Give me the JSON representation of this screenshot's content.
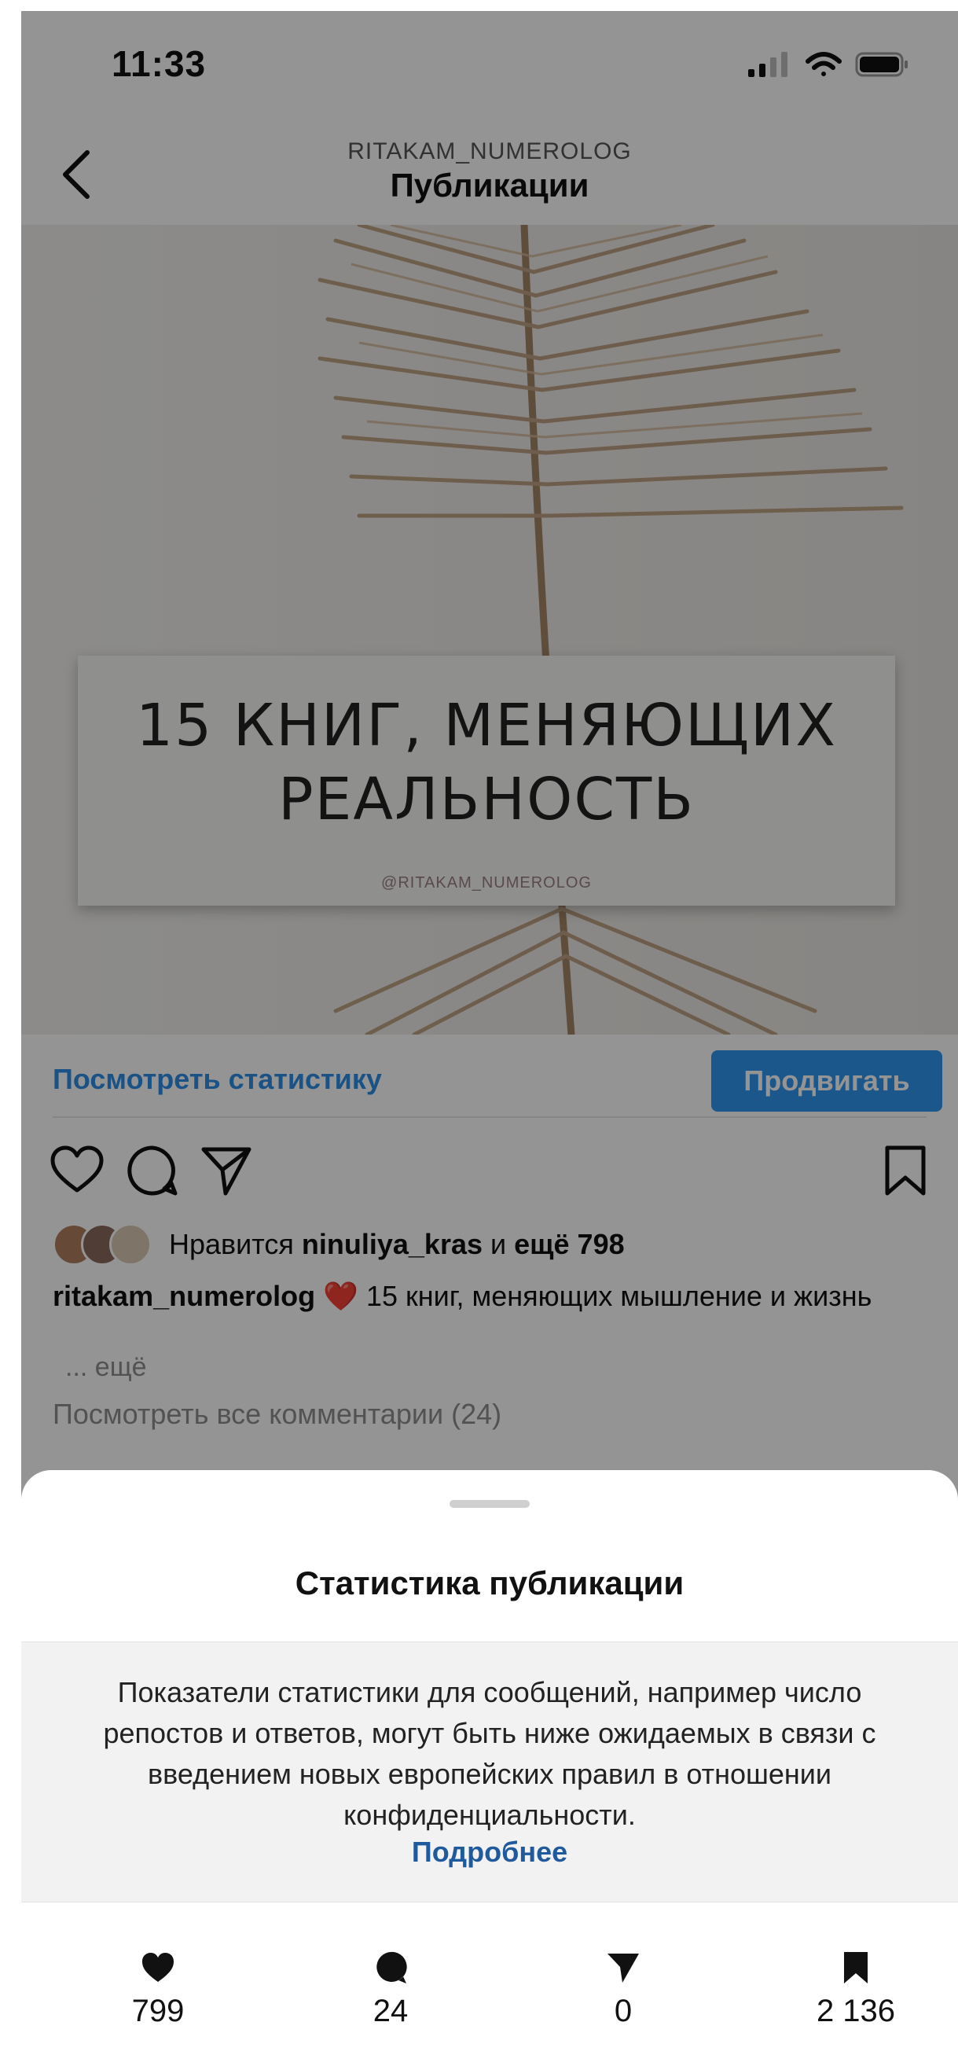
{
  "status_bar": {
    "time": "11:33"
  },
  "nav": {
    "subtitle": "RITAKAM_NUMEROLOG",
    "title": "Публикации"
  },
  "post_image": {
    "headline_line1": "15 КНИГ, МЕНЯЮЩИХ",
    "headline_line2": "РЕАЛЬНОСТЬ",
    "watermark": "@RITAKAM_NUMEROLOG"
  },
  "actions": {
    "view_stats_label": "Посмотреть статистику",
    "promote_label": "Продвигать"
  },
  "likes": {
    "prefix": "Нравится",
    "user": "ninuliya_kras",
    "middle": "и",
    "others": "ещё 798"
  },
  "caption": {
    "username": "ritakam_numerolog",
    "emoji": "❤️",
    "text": "15 книг, меняющих мышление и жизнь",
    "more": "... ещё"
  },
  "comments_link": "Посмотреть все комментарии (24)",
  "sheet": {
    "title": "Статистика публикации",
    "notice": "Показатели статистики для сообщений, например число репостов и ответов, могут быть ниже ожидаемых в связи с введением новых европейских правил в отношении конфиденциальности.",
    "learn_more": "Подробнее",
    "metrics": [
      {
        "icon": "heart-icon",
        "value": "799"
      },
      {
        "icon": "comment-icon",
        "value": "24"
      },
      {
        "icon": "send-icon",
        "value": "0"
      },
      {
        "icon": "bookmark-icon",
        "value": "2 136"
      }
    ]
  },
  "colors": {
    "accent": "#2f96f0",
    "link_blue": "#1f5a9c",
    "overlay": "rgba(0,0,0,0.42)"
  }
}
